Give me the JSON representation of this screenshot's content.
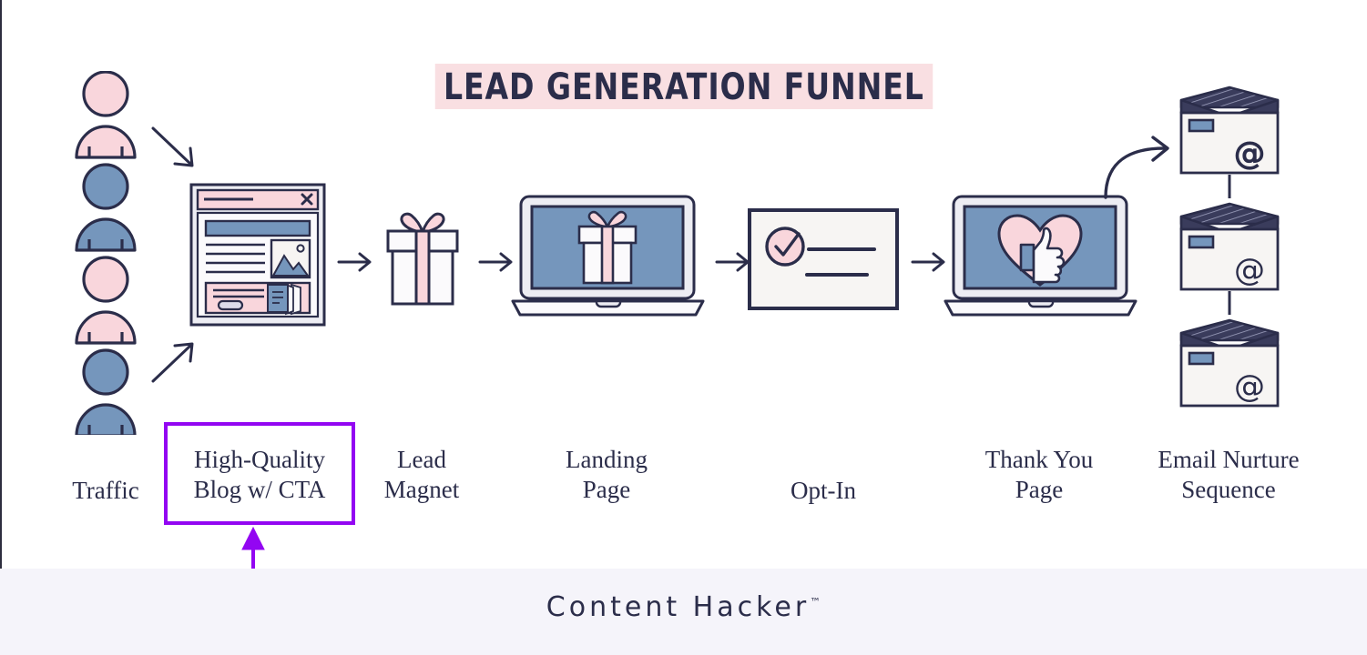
{
  "title": "LEAD GENERATION FUNNEL",
  "brand": {
    "name": "Content Hacker",
    "tm": "™"
  },
  "colors": {
    "ink": "#2B2D4A",
    "blue": "#7596BC",
    "pink": "#F9D6DC",
    "pink_highlight": "#F9DFE2",
    "paper": "#F7F5F3",
    "purple_accent": "#9306F2",
    "footer_band": "#F5F4FA",
    "page_background": "#FFFFFF"
  },
  "stages": [
    {
      "id": "traffic",
      "label": "Traffic",
      "icon": "people-group-icon"
    },
    {
      "id": "blog",
      "label": "High-Quality\nBlog w/ CTA",
      "icon": "browser-window-icon"
    },
    {
      "id": "lead-magnet",
      "label": "Lead\nMagnet",
      "icon": "gift-box-icon"
    },
    {
      "id": "landing",
      "label": "Landing\nPage",
      "icon": "laptop-gift-icon"
    },
    {
      "id": "optin",
      "label": "Opt-In",
      "icon": "optin-form-icon"
    },
    {
      "id": "thankyou",
      "label": "Thank You\nPage",
      "icon": "laptop-heart-thumbsup-icon"
    },
    {
      "id": "email",
      "label": "Email Nurture\nSequence",
      "icon": "envelope-stack-icon"
    }
  ],
  "annotation": {
    "highlight_stage": "blog",
    "highlight_text": "High-Quality\nBlog w/ CTA",
    "arrow": "up-arrow-annotation"
  },
  "people": [
    {
      "index": 0,
      "color": "pink"
    },
    {
      "index": 1,
      "color": "blue"
    },
    {
      "index": 2,
      "color": "pink"
    },
    {
      "index": 3,
      "color": "blue"
    }
  ],
  "envelopes": [
    {
      "index": 0,
      "symbol": "@"
    },
    {
      "index": 1,
      "symbol": "@"
    },
    {
      "index": 2,
      "symbol": "@"
    }
  ],
  "connectors": {
    "straight_arrows": 5,
    "diagonal_arrows": 2,
    "curved_arrow": 1,
    "vertical_links": 2
  }
}
